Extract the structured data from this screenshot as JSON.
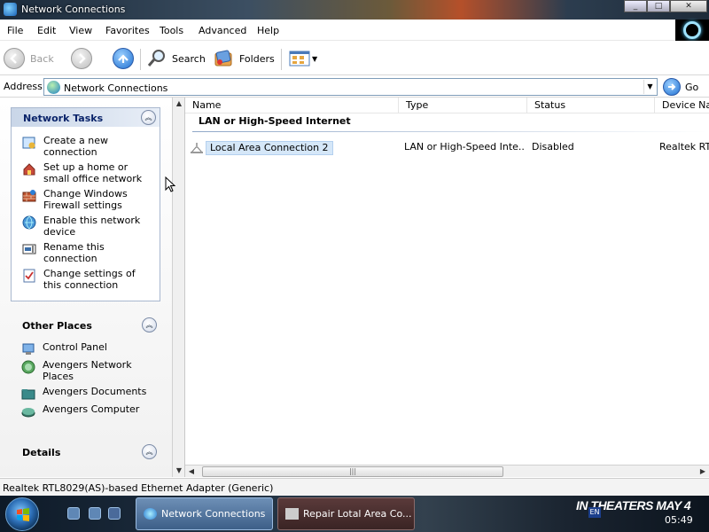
{
  "window": {
    "title": "Network Connections"
  },
  "menu": [
    "File",
    "Edit",
    "View",
    "Favorites",
    "Tools",
    "Advanced",
    "Help"
  ],
  "toolbar": {
    "back": "Back",
    "search": "Search",
    "folders": "Folders"
  },
  "address": {
    "label": "Address",
    "value": "Network Connections",
    "go": "Go"
  },
  "tasks": {
    "network_tasks": {
      "title": "Network Tasks",
      "items": [
        "Create a new connection",
        "Set up a home or small office network",
        "Change Windows Firewall settings",
        "Enable this network device",
        "Rename this connection",
        "Change settings of this connection"
      ]
    },
    "other_places": {
      "title": "Other Places",
      "items": [
        "Control Panel",
        "Avengers Network Places",
        "Avengers Documents",
        "Avengers Computer"
      ]
    },
    "details": {
      "title": "Details"
    }
  },
  "list": {
    "columns": [
      "Name",
      "Type",
      "Status",
      "Device Nar"
    ],
    "group": "LAN or High-Speed Internet",
    "rows": [
      {
        "name": "Local Area Connection 2",
        "type": "LAN or High-Speed Inte...",
        "status": "Disabled",
        "device": "Realtek RTL"
      }
    ]
  },
  "statusbar": {
    "text": "Realtek RTL8029(AS)-based Ethernet Adapter (Generic)"
  },
  "taskbar": {
    "buttons": [
      "Network Connections",
      "Repair Lotal Area Co..."
    ],
    "promo": "IN THEATERS MAY 4",
    "lang": "EN",
    "clock": "05:49"
  },
  "colors": {
    "link_blue": "#0a246a",
    "selection": "#d5e7f8",
    "taskbar_active": "#3d5f88"
  }
}
